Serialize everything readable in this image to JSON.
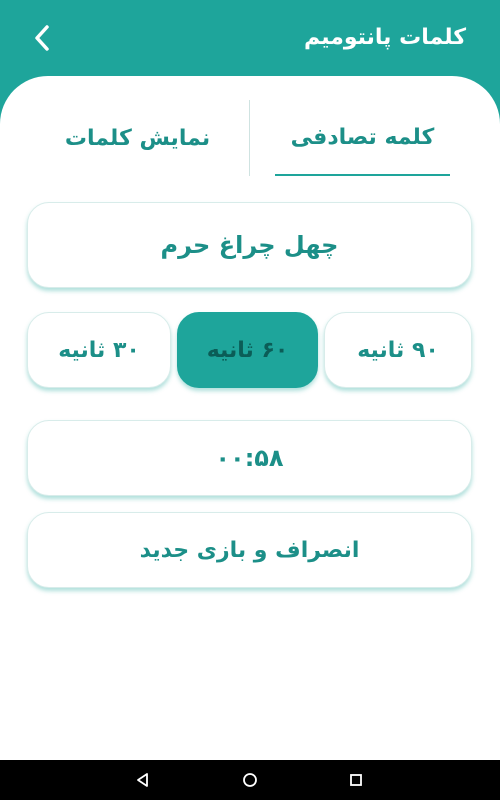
{
  "header": {
    "title": "کلمات پانتومیم",
    "back_icon": "chevron-left-icon"
  },
  "tabs": [
    {
      "label": "کلمه تصادفی",
      "selected": true
    },
    {
      "label": "نمایش کلمات",
      "selected": false
    }
  ],
  "word": "چهل چراغ حرم",
  "time_options": [
    {
      "label": "۹۰ ثانیه",
      "selected": false
    },
    {
      "label": "۶۰ ثانیه",
      "selected": true
    },
    {
      "label": "۳۰ ثانیه",
      "selected": false
    }
  ],
  "timer": "۰۰:۵۸",
  "reset_label": "انصراف و بازی جدید",
  "navbar": {
    "back_icon": "triangle-back-icon",
    "home_icon": "circle-home-icon",
    "recents_icon": "square-recents-icon"
  },
  "colors": {
    "accent": "#1ea59b",
    "text": "#1c8f88",
    "selected_text": "#0b5d57",
    "background": "#ffffff"
  }
}
